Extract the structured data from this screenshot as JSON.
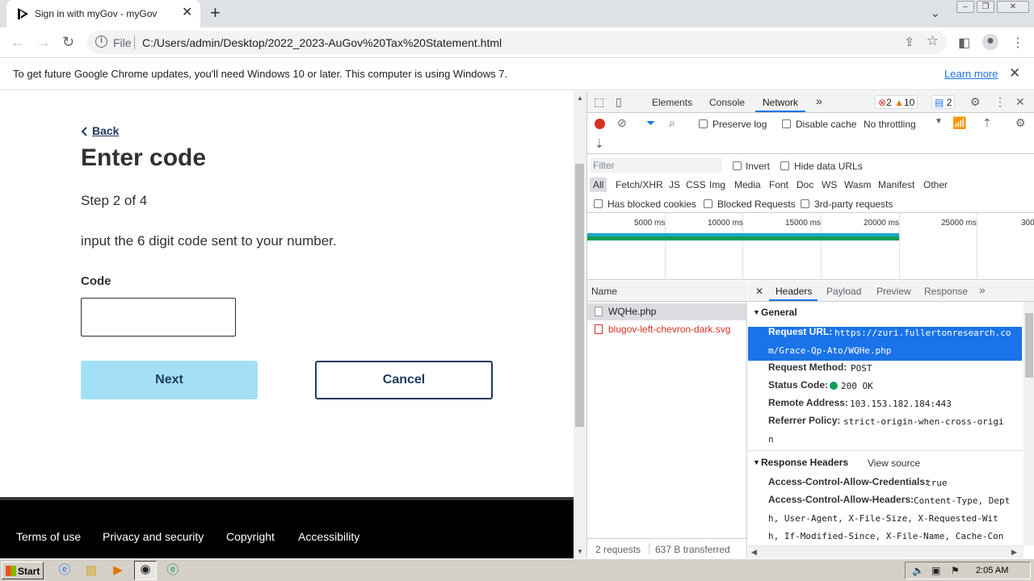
{
  "browser": {
    "tab_title": "Sign in with myGov - myGov",
    "tab_close": "✕",
    "new_tab": "+",
    "address_scheme": "File",
    "address_url": "C:/Users/admin/Desktop/2022_2023-AuGov%20Tax%20Statement.html",
    "infobar_message": "To get future Google Chrome updates, you'll need Windows 10 or later. This computer is using Windows 7.",
    "infobar_link": "Learn more"
  },
  "page": {
    "back": "Back",
    "heading": "Enter code",
    "step": "Step 2 of 4",
    "instruction": "input the 6 digit code sent to your number.",
    "code_label": "Code",
    "code_value": "",
    "next_label": "Next",
    "cancel_label": "Cancel",
    "footer_links": [
      "Terms of use",
      "Privacy and security",
      "Copyright",
      "Accessibility"
    ]
  },
  "devtools": {
    "tabs": [
      "Elements",
      "Console",
      "Network"
    ],
    "more": "»",
    "errors": "2",
    "warnings": "10",
    "messages": "2",
    "preserve_log": "Preserve log",
    "disable_cache": "Disable cache",
    "throttling": "No throttling",
    "filter_placeholder": "Filter",
    "invert": "Invert",
    "hide_data_urls": "Hide data URLs",
    "filter_types": [
      "All",
      "Fetch/XHR",
      "JS",
      "CSS",
      "Img",
      "Media",
      "Font",
      "Doc",
      "WS",
      "Wasm",
      "Manifest",
      "Other"
    ],
    "has_blocked_cookies": "Has blocked cookies",
    "blocked_requests": "Blocked Requests",
    "third_party": "3rd-party requests",
    "timeline_ticks": [
      "5000 ms",
      "10000 ms",
      "15000 ms",
      "20000 ms",
      "25000 ms",
      "300"
    ],
    "name_header": "Name",
    "requests": [
      {
        "name": "WQHe.php",
        "color": "#202124"
      },
      {
        "name": "blugov-left-chevron-dark.svg",
        "color": "#d93025"
      }
    ],
    "status_requests": "2 requests",
    "status_transferred": "637 B transferred",
    "detail_tabs": [
      "Headers",
      "Payload",
      "Preview",
      "Response"
    ],
    "general_title": "General",
    "request_url_key": "Request URL:",
    "request_url_line1": "https://zuri.fullertonresearch.co",
    "request_url_line2": "m/Grace-Qp-Ato/WQHe.php",
    "request_method_key": "Request Method:",
    "request_method": "POST",
    "status_code_key": "Status Code:",
    "status_code": "200 OK",
    "remote_address_key": "Remote Address:",
    "remote_address": "103.153.182.184:443",
    "referrer_policy_key": "Referrer Policy:",
    "referrer_policy_line1": "strict-origin-when-cross-origi",
    "referrer_policy_line2": "n",
    "response_headers_title": "Response Headers",
    "view_source": "View source",
    "acac_key": "Access-Control-Allow-Credentials:",
    "acac_val": "true",
    "acah_key": "Access-Control-Allow-Headers:",
    "acah_line1": "Content-Type, Dept",
    "acah_line2": "h, User-Agent, X-File-Size, X-Requested-Wit",
    "acah_line3": "h, If-Modified-Since, X-File-Name, Cache-Con"
  },
  "taskbar": {
    "start": "Start",
    "clock": "2:05 AM"
  }
}
